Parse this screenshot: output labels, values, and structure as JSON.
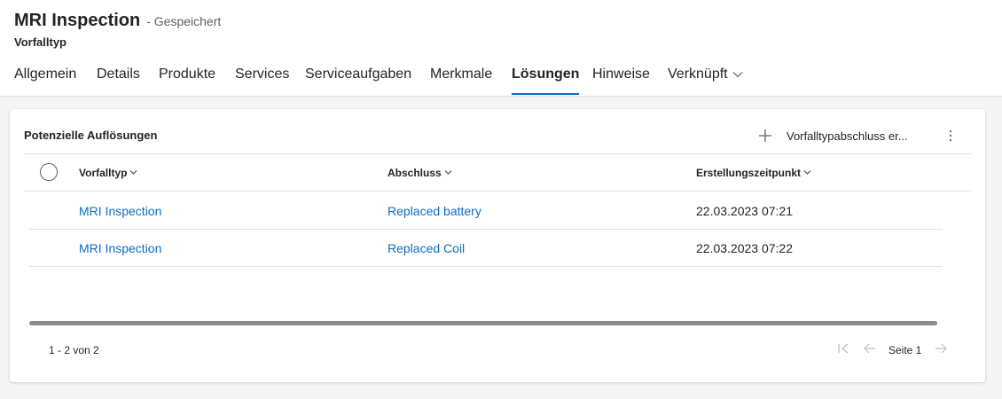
{
  "header": {
    "title": "MRI Inspection",
    "saved_status": "- Gespeichert",
    "entity_type": "Vorfalltyp"
  },
  "tabs": [
    {
      "label": "Allgemein",
      "active": false
    },
    {
      "label": "Details",
      "active": false
    },
    {
      "label": "Produkte",
      "active": false
    },
    {
      "label": "Services",
      "active": false
    },
    {
      "label": "Serviceaufgaben",
      "active": false
    },
    {
      "label": "Merkmale",
      "active": false
    },
    {
      "label": "Lösungen",
      "active": true
    },
    {
      "label": "Hinweise",
      "active": false
    },
    {
      "label": "Verknüpft",
      "active": false,
      "icon": "chevron-down-icon"
    }
  ],
  "colors": {
    "accent": "#0f6cbd",
    "link": "#0f6cbd",
    "text": "#242424",
    "page_background": "#f5f5f5"
  },
  "subgrid": {
    "title": "Potenzielle Auflösungen",
    "add_command_label": "Vorfalltypabschluss er...",
    "add_command_icon": "plus-icon",
    "more_icon": "more-vertical-icon",
    "columns": [
      {
        "label": "Vorfalltyp",
        "icon": "chevron-down-icon"
      },
      {
        "label": "Abschluss",
        "icon": "chevron-down-icon"
      },
      {
        "label": "Erstellungszeitpunkt",
        "icon": "chevron-down-icon"
      }
    ],
    "rows": [
      {
        "vorfalltyp": "MRI Inspection",
        "abschluss": "Replaced battery",
        "erstellungszeitpunkt": "22.03.2023 07:21"
      },
      {
        "vorfalltyp": "MRI Inspection",
        "abschluss": "Replaced Coil",
        "erstellungszeitpunkt": "22.03.2023 07:22"
      }
    ],
    "record_count": "1 - 2 von 2",
    "page_label": "Seite 1",
    "pager_icons": [
      "first-page-icon",
      "previous-page-icon",
      "next-page-icon"
    ]
  }
}
